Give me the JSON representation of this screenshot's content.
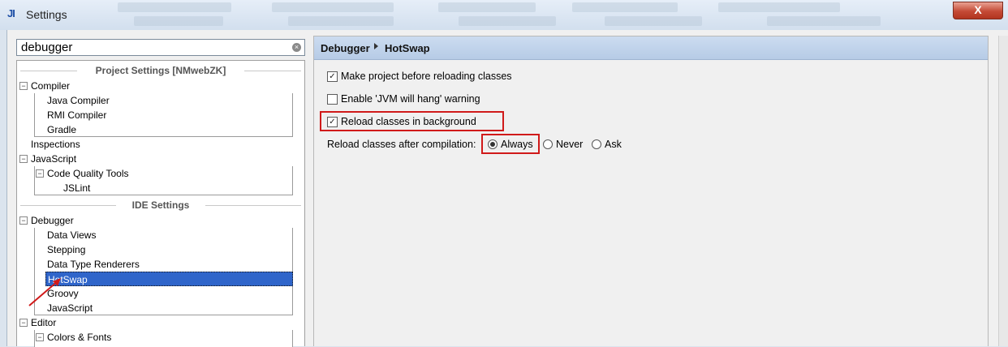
{
  "window": {
    "title": "Settings",
    "icon_text": "JI",
    "close_label": "X"
  },
  "search": {
    "value": "debugger",
    "clear_icon": "clear-icon"
  },
  "tree": {
    "project_header": "Project Settings [NMwebZK]",
    "ide_header": "IDE Settings",
    "compiler": {
      "label": "Compiler",
      "children": [
        "Java Compiler",
        "RMI Compiler",
        "Gradle"
      ]
    },
    "inspections": "Inspections",
    "javascript": {
      "label": "JavaScript",
      "code_quality": "Code Quality Tools",
      "jslint": "JSLint"
    },
    "debugger": {
      "label": "Debugger",
      "children": [
        "Data Views",
        "Stepping",
        "Data Type Renderers",
        "HotSwap",
        "Groovy",
        "JavaScript"
      ],
      "selected": "HotSwap"
    },
    "editor": {
      "label": "Editor",
      "colors_fonts": "Colors & Fonts"
    }
  },
  "breadcrumb": {
    "parent": "Debugger",
    "current": "HotSwap"
  },
  "options": {
    "make_project": {
      "label": "Make project before reloading classes",
      "checked": true
    },
    "jvm_hang": {
      "label": "Enable 'JVM will hang' warning",
      "checked": false
    },
    "reload_background": {
      "label": "Reload classes in background",
      "checked": true
    },
    "reload_after_label": "Reload classes after compilation:",
    "radios": [
      {
        "label": "Always",
        "selected": true
      },
      {
        "label": "Never",
        "selected": false
      },
      {
        "label": "Ask",
        "selected": false
      }
    ]
  },
  "colors": {
    "selection": "#2f65ca",
    "highlight_red": "#d01a1a",
    "crumb_bar": "#c4d6ee"
  }
}
